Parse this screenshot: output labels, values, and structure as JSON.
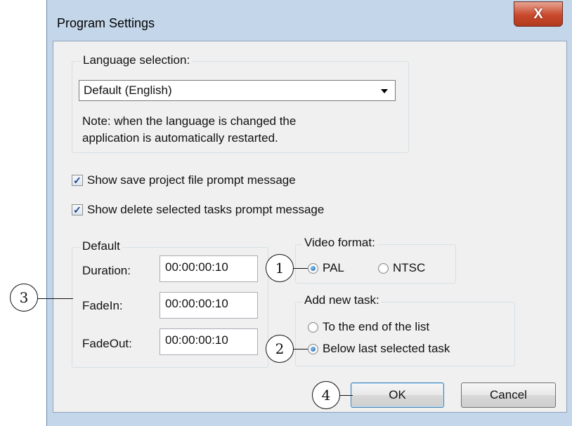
{
  "window": {
    "title": "Program Settings",
    "close_glyph": "X"
  },
  "language": {
    "group_label": "Language selection:",
    "selected": "Default (English)",
    "note_line1": "Note: when the language is changed the",
    "note_line2": "application is automatically restarted."
  },
  "options": {
    "save_prompt": {
      "label": "Show save project file prompt message",
      "checked": true
    },
    "delete_prompt": {
      "label": "Show delete selected tasks prompt message",
      "checked": true
    }
  },
  "defaults": {
    "group_label": "Default",
    "duration_label": "Duration:",
    "duration_value": "00:00:00:10",
    "fadein_label": "FadeIn:",
    "fadein_value": "00:00:00:10",
    "fadeout_label": "FadeOut:",
    "fadeout_value": "00:00:00:10"
  },
  "video_format": {
    "group_label": "Video format:",
    "pal_label": "PAL",
    "ntsc_label": "NTSC",
    "selected": "PAL"
  },
  "add_task": {
    "group_label": "Add new task:",
    "end_label": "To the end of the list",
    "below_label": "Below last selected task",
    "selected": "Below last selected task"
  },
  "buttons": {
    "ok": "OK",
    "cancel": "Cancel"
  },
  "callouts": {
    "c1": "1",
    "c2": "2",
    "c3": "3",
    "c4": "4"
  },
  "colors": {
    "frame": "#c4d6ea",
    "close": "#c8482b",
    "radio_on": "#1c5fa8"
  }
}
